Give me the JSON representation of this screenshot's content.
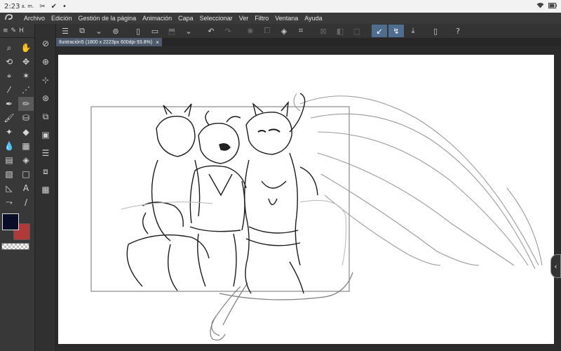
{
  "status_bar": {
    "time": "2:23",
    "ampm": "a. m.",
    "notification_icons": [
      "scissors-icon",
      "check-icon",
      "dot-icon"
    ],
    "right_icons": [
      "wifi-icon",
      "battery-icon"
    ]
  },
  "menu": {
    "items": [
      "Archivo",
      "Edición",
      "Gestión de la página",
      "Animación",
      "Capa",
      "Seleccionar",
      "Ver",
      "Filtro",
      "Ventana",
      "Ayuda"
    ]
  },
  "document": {
    "tab_label": "Ilustración5 (1800 x 2223px 600dpi 93.8%)",
    "close_glyph": "×"
  },
  "tools": {
    "tab_labels": [
      "H"
    ],
    "items": [
      "pen",
      "hand",
      "zoom",
      "move",
      "select",
      "auto-select",
      "eyedropper",
      "magic",
      "pencil",
      "brush",
      "eraser",
      "fill",
      "blend",
      "gradient",
      "figure",
      "ruler",
      "frame",
      "text",
      "balloon",
      "line",
      "color-mix",
      "correct"
    ]
  },
  "colors": {
    "main": "#0a0d26",
    "sub": "#b03a3a",
    "accent": "#4f6e8f"
  }
}
